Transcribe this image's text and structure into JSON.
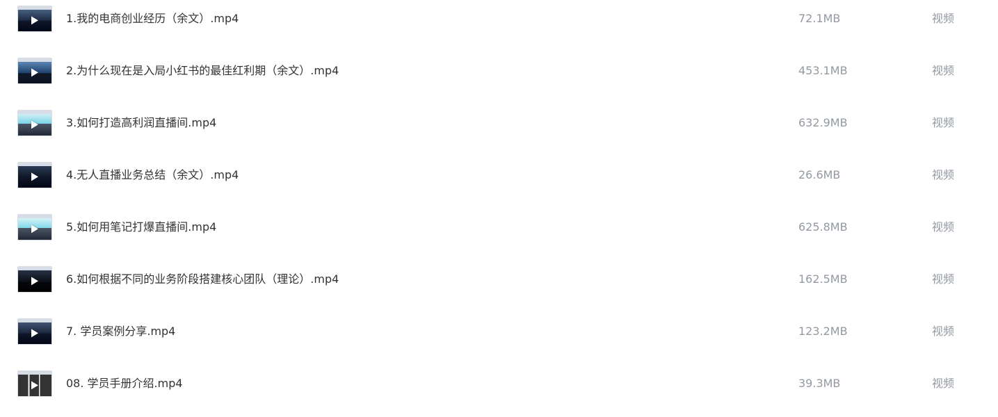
{
  "files": [
    {
      "name": "1.我的电商创业经历（余文）.mp4",
      "size": "72.1MB",
      "type": "视频",
      "thumb_style": "dark-stage",
      "thumb_colors": [
        "#1f2b45",
        "#46607f"
      ],
      "icon": "play-icon"
    },
    {
      "name": "2.为什么现在是入局小红书的最佳红利期（余文）.mp4",
      "size": "453.1MB",
      "type": "视频",
      "thumb_style": "blue-stage",
      "thumb_colors": [
        "#20406d",
        "#5b86b4"
      ],
      "icon": "play-icon"
    },
    {
      "name": "3.如何打造高利润直播间.mp4",
      "size": "632.9MB",
      "type": "视频",
      "thumb_style": "light-screen",
      "thumb_colors": [
        "#79d4e6",
        "#cfeff5"
      ],
      "icon": "play-icon"
    },
    {
      "name": "4.无人直播业务总结（余文）.mp4",
      "size": "26.6MB",
      "type": "视频",
      "thumb_style": "dark-stage",
      "thumb_colors": [
        "#111827",
        "#2d3b55"
      ],
      "icon": "play-icon"
    },
    {
      "name": "5.如何用笔记打爆直播间.mp4",
      "size": "625.8MB",
      "type": "视频",
      "thumb_style": "light-screen",
      "thumb_colors": [
        "#82d9ea",
        "#d5f3f8"
      ],
      "icon": "play-icon"
    },
    {
      "name": "6.如何根据不同的业务阶段搭建核心团队（理论）.mp4",
      "size": "162.5MB",
      "type": "视频",
      "thumb_style": "dark-audience",
      "thumb_colors": [
        "#090d14",
        "#273246"
      ],
      "icon": "play-icon"
    },
    {
      "name": "7. 学员案例分享.mp4",
      "size": "123.2MB",
      "type": "视频",
      "thumb_style": "dark-stage",
      "thumb_colors": [
        "#1c2740",
        "#40516f"
      ],
      "icon": "play-icon"
    },
    {
      "name": "08. 学员手册介绍.mp4",
      "size": "39.3MB",
      "type": "视频",
      "thumb_style": "document",
      "thumb_colors": [
        "#f4f4f4",
        "#333333"
      ],
      "icon": "play-icon"
    }
  ],
  "colors": {
    "name_text": "#333333",
    "secondary_text": "#9499a1",
    "background": "#ffffff"
  }
}
